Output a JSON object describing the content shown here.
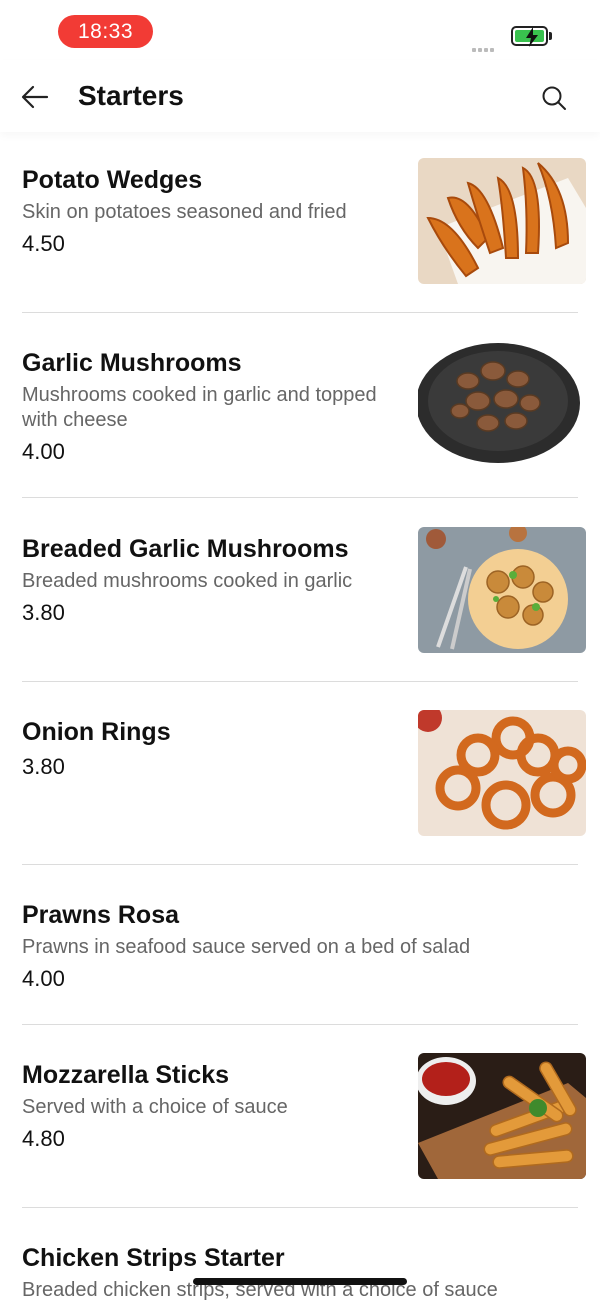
{
  "status_bar": {
    "time": "18:33"
  },
  "header": {
    "title": "Starters"
  },
  "items": [
    {
      "name": "Potato Wedges",
      "description": "Skin on potatoes seasoned and fried",
      "price": "4.50",
      "image": "potato-wedges-photo"
    },
    {
      "name": "Garlic Mushrooms",
      "description": "Mushrooms cooked in garlic and topped with cheese",
      "price": "4.00",
      "image": "garlic-mushrooms-photo"
    },
    {
      "name": "Breaded Garlic Mushrooms",
      "description": "Breaded mushrooms cooked in garlic",
      "price": "3.80",
      "image": "breaded-mushrooms-photo"
    },
    {
      "name": "Onion Rings",
      "description": "",
      "price": "3.80",
      "image": "onion-rings-photo"
    },
    {
      "name": "Prawns Rosa",
      "description": "Prawns in seafood sauce served on a bed of salad",
      "price": "4.00",
      "image": ""
    },
    {
      "name": "Mozzarella Sticks",
      "description": "Served with a choice of sauce",
      "price": "4.80",
      "image": "mozzarella-sticks-photo"
    },
    {
      "name": "Chicken Strips Starter",
      "description": "Breaded chicken strips, served with a choice of sauce",
      "price": "",
      "image": ""
    }
  ]
}
